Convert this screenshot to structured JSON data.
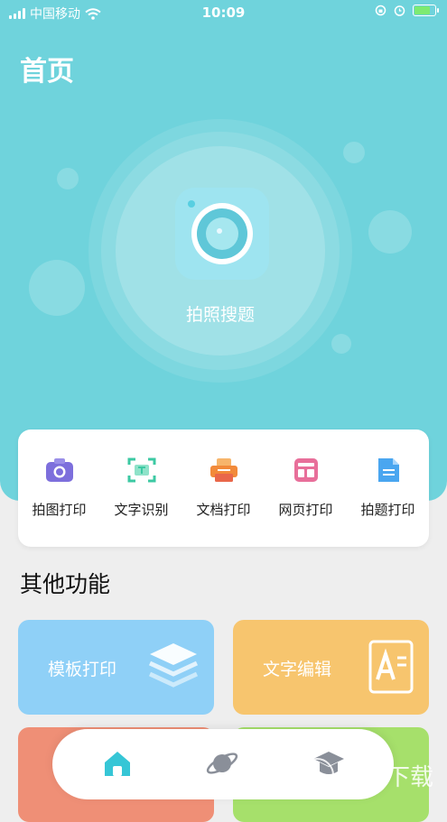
{
  "status_bar": {
    "carrier": "中国移动",
    "time": "10:09"
  },
  "page": {
    "title": "首页"
  },
  "photo_search": {
    "label": "拍照搜题",
    "icon": "camera-icon"
  },
  "tools": [
    {
      "label": "拍图打印",
      "icon": "camera-icon",
      "color": "#7d6fdc"
    },
    {
      "label": "文字识别",
      "icon": "scan-icon",
      "color": "#3cc9a3"
    },
    {
      "label": "文档打印",
      "icon": "printer-icon",
      "color": "#f28a3a"
    },
    {
      "label": "网页打印",
      "icon": "webpage-icon",
      "color": "#e86f9a"
    },
    {
      "label": "拍题打印",
      "icon": "document-icon",
      "color": "#4aa6f0"
    }
  ],
  "other": {
    "title": "其他功能",
    "features": [
      {
        "label": "模板打印",
        "icon": "layers-icon",
        "color": "#8fd0f7"
      },
      {
        "label": "文字编辑",
        "icon": "text-edit-icon",
        "color": "#f7c56e"
      },
      {
        "label": "",
        "color": "#ef8f76"
      },
      {
        "label": "",
        "color": "#a6e06b"
      }
    ]
  },
  "nav": [
    {
      "icon": "home-icon",
      "color": "#36c6d6"
    },
    {
      "icon": "planet-icon",
      "color": "#8a8f99"
    },
    {
      "icon": "graduation-cap-icon",
      "color": "#8a8f99"
    }
  ],
  "watermark": {
    "text": "一听下载"
  }
}
